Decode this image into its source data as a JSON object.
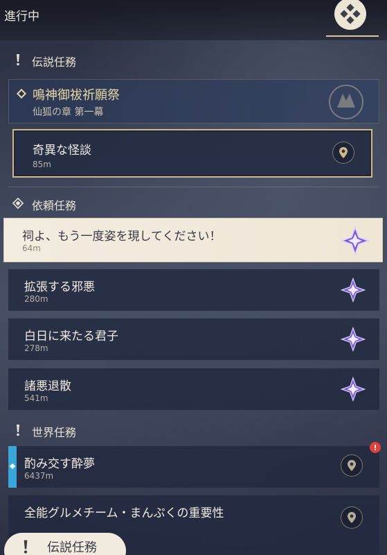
{
  "header": {
    "title": "進行中",
    "menu_icon": "quest-menu-icon"
  },
  "sections": {
    "legend": {
      "label": "伝説任務",
      "icon": "exclamation-icon"
    },
    "commission": {
      "label": "依頼任務",
      "icon": "commission-diamond-icon"
    },
    "world": {
      "label": "世界任務",
      "icon": "exclamation-icon"
    }
  },
  "legend_quest": {
    "title": "鳴神御祓祈願祭",
    "subtitle": "仙狐の章 第一幕",
    "emblem": "fox-emblem-icon",
    "tasks": [
      {
        "title": "奇異な怪談",
        "distance": "85m",
        "icon": "map-marker-icon"
      }
    ]
  },
  "commission_quests": [
    {
      "title": "祠よ、もう一度姿を現してください！",
      "distance": "64m",
      "icon": "commission-star-icon",
      "selected": true
    },
    {
      "title": "拡張する邪悪",
      "distance": "280m",
      "icon": "commission-star-icon"
    },
    {
      "title": "白日に来たる君子",
      "distance": "278m",
      "icon": "commission-star-icon"
    },
    {
      "title": "諸悪退散",
      "distance": "541m",
      "icon": "commission-star-icon"
    }
  ],
  "world_quests": [
    {
      "title": "酌み交す酔夢",
      "distance": "6437m",
      "icon": "map-marker-icon",
      "alert": "!"
    },
    {
      "title": "全能グルメチーム・まんぷくの重要性",
      "distance": "",
      "icon": "map-marker-icon"
    }
  ],
  "bottom_button": {
    "label": "伝説任務",
    "icon": "exclamation-icon"
  },
  "colors": {
    "accent_gold": "#cdb98a",
    "world_blue": "#3aa6d8",
    "commission_purple": "#7a5bd6",
    "alert_red": "#e2403c"
  }
}
